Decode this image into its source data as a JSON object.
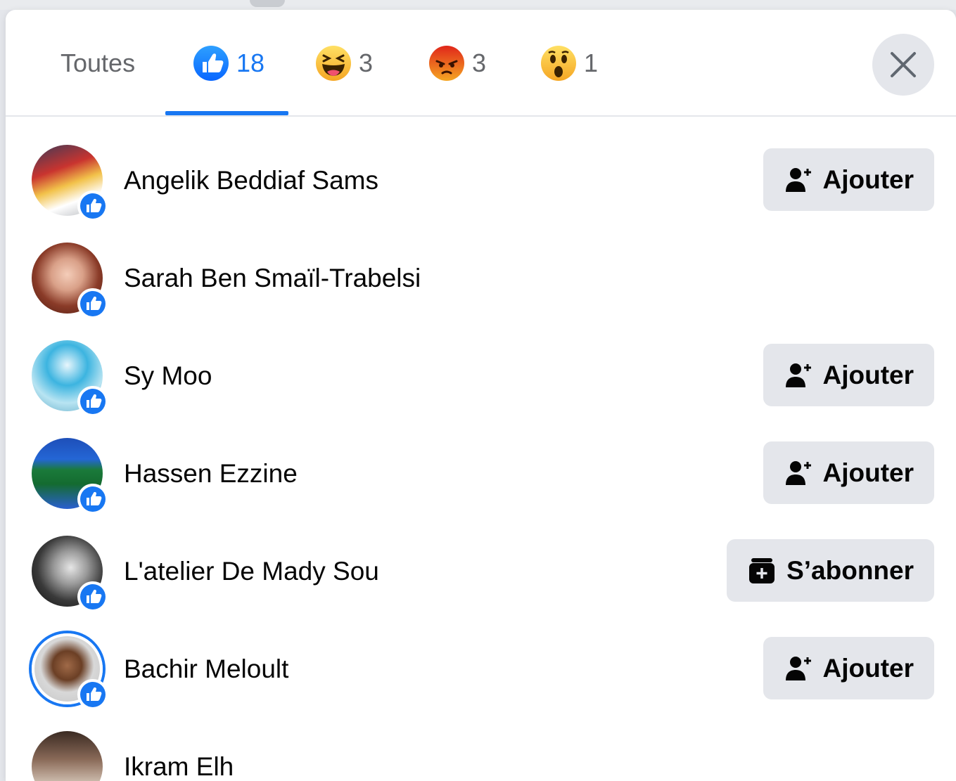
{
  "tabs": [
    {
      "label": "Toutes",
      "count": ""
    },
    {
      "label": "",
      "count": "18",
      "reaction": "like"
    },
    {
      "label": "",
      "count": "3",
      "reaction": "haha"
    },
    {
      "label": "",
      "count": "3",
      "reaction": "angry"
    },
    {
      "label": "",
      "count": "1",
      "reaction": "wow"
    }
  ],
  "active_tab": 1,
  "colors": {
    "accent": "#1877f2",
    "button_bg": "#e4e6eb",
    "muted_text": "#65676b"
  },
  "people": [
    {
      "name": "Angelik Beddiaf Sams",
      "action": "Ajouter",
      "action_icon": "add-friend-icon"
    },
    {
      "name": "Sarah Ben Smaïl-Trabelsi",
      "action": "",
      "action_icon": ""
    },
    {
      "name": "Sy Moo",
      "action": "Ajouter",
      "action_icon": "add-friend-icon"
    },
    {
      "name": "Hassen Ezzine",
      "action": "Ajouter",
      "action_icon": "add-friend-icon"
    },
    {
      "name": "L'atelier De Mady Sou",
      "action": "S’abonner",
      "action_icon": "follow-icon"
    },
    {
      "name": "Bachir Meloult",
      "action": "Ajouter",
      "action_icon": "add-friend-icon"
    },
    {
      "name": "Ikram Elh",
      "action": "",
      "action_icon": ""
    }
  ]
}
